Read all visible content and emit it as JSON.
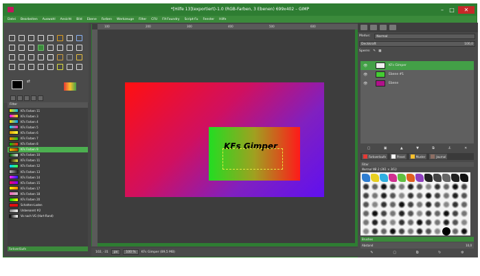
{
  "window": {
    "title": "*[Hilfe 13](exportiert)-1.0 (RGB-Farben, 3 Ebenen) 699x402 – GIMP",
    "min": "–",
    "max": "□",
    "close": "✕"
  },
  "menu": [
    "Datei",
    "Bearbeiten",
    "Auswahl",
    "Ansicht",
    "Bild",
    "Ebene",
    "Farben",
    "Werkzeuge",
    "Filter",
    "CFU",
    "FX-Foundry",
    "Script-Fu",
    "Fenster",
    "Hilfe"
  ],
  "rulers": [
    "100",
    "200",
    "300",
    "400",
    "500",
    "600"
  ],
  "toolbox": {
    "swap": "⇄",
    "tool_icons": [
      "rect-select-icon",
      "ellipse-select-icon",
      "lasso-icon",
      "fuzzy-select-icon",
      "color-select-icon",
      "scissors-icon",
      "foreground-select-icon",
      "paths-icon",
      "color-picker-icon",
      "zoom-icon",
      "measure-icon",
      "move-icon",
      "align-icon",
      "crop-icon",
      "rotate-icon",
      "scale-icon",
      "shear-icon",
      "perspective-icon",
      "flip-icon",
      "cage-icon",
      "text-icon",
      "bucket-fill-icon",
      "blend-icon",
      "pencil-icon",
      "paintbrush-icon",
      "eraser-icon",
      "airbrush-icon",
      "ink-icon",
      "clone-icon",
      "heal-icon",
      "smudge-icon",
      "dodge-icon"
    ],
    "colors": {
      "fg": "#000000",
      "bg": "#ffffff"
    }
  },
  "gradients": {
    "header": "Filter",
    "selected_index": 7,
    "items": [
      {
        "name": "KFs Farben 11",
        "c1": "#f2e600",
        "c2": "#10b8e8"
      },
      {
        "name": "KFs Farben 3",
        "c1": "#ff00ff",
        "c2": "#e8e800"
      },
      {
        "name": "KFs Farben 4",
        "c1": "#ffdd00",
        "c2": "#00a0ff"
      },
      {
        "name": "KFs Farben 5",
        "c1": "#00e0e0",
        "c2": "#ff30a0"
      },
      {
        "name": "KFs Farben 6",
        "c1": "#e0a000",
        "c2": "#ffff40"
      },
      {
        "name": "KFs Farben 7",
        "c1": "#ff8800",
        "c2": "#20c020"
      },
      {
        "name": "KFs Farben 8",
        "c1": "#00cc00",
        "c2": "#ff2020"
      },
      {
        "name": "KFs Farben 9",
        "c1": "#f0c000",
        "c2": "#b04000"
      },
      {
        "name": "KFs Farben 10",
        "c1": "#006000",
        "c2": "#e0e0e0"
      },
      {
        "name": "KFs Farben 11",
        "c1": "#111111",
        "c2": "#e0e040"
      },
      {
        "name": "KFs Farben 12",
        "c1": "#00c8ff",
        "c2": "#40ff40"
      },
      {
        "name": "KFs Farben 13",
        "c1": "#bbbbbb",
        "c2": "#222222"
      },
      {
        "name": "KFs Farben 14",
        "c1": "#ff20ff",
        "c2": "#2020ff"
      },
      {
        "name": "KFs Farben 15",
        "c1": "#ff0060",
        "c2": "#8000ff"
      },
      {
        "name": "KFs Farben 17",
        "c1": "#f0f000",
        "c2": "#ff8000"
      },
      {
        "name": "KFs Farben 18",
        "c1": "#ff60c0",
        "c2": "#c0c0c0"
      },
      {
        "name": "KFs Farben 20",
        "c1": "#00d000",
        "c2": "#ffff00"
      },
      {
        "name": "Schatten-Laden",
        "c1": "#e01010",
        "c2": "#e01010"
      },
      {
        "name": "Unbenannt #2",
        "c1": "#808080",
        "c2": "#f0f0f0"
      },
      {
        "name": "Vo nach VG (Hart-Rand)",
        "c1": "#000000",
        "c2": "#ffffff"
      }
    ],
    "footer": "Farbverläufe"
  },
  "canvas": {
    "text": "KFs Gimper"
  },
  "status": {
    "coords": "102, -31",
    "unit": "px",
    "zoom": "100 %",
    "layer_info": "KFs Gimper (89,5 MB)"
  },
  "right_dock": {
    "mode_label": "Modus:",
    "mode_value": "Normal",
    "opacity_label": "Deckkraft",
    "opacity_value": "100,0",
    "lock_label": "Sperre:",
    "layers": [
      {
        "name": "KFs Gimper",
        "thumb": "#f0f0f0",
        "selected": true
      },
      {
        "name": "Ebene #1",
        "thumb": "#44cc33",
        "selected": false
      },
      {
        "name": "Ebene",
        "thumb": "#b0108a",
        "selected": false
      }
    ],
    "layer_buttons": [
      "▢",
      "▣",
      "▲",
      "▼",
      "⧉",
      "⚓",
      "✕"
    ],
    "brush_tabs": [
      "Farbverlaufe",
      "Pinsel",
      "Muster",
      "Journal"
    ],
    "brush_filter": "Filter",
    "brush_name": "Normal NB 2 (361 × 361)",
    "brush_footer": "Brushes",
    "brush_spacing_label": "Abstand",
    "brush_spacing_value": "10,0",
    "dock_buttons": [
      "✎",
      "▢",
      "⧉",
      "↻",
      "⚙"
    ]
  }
}
